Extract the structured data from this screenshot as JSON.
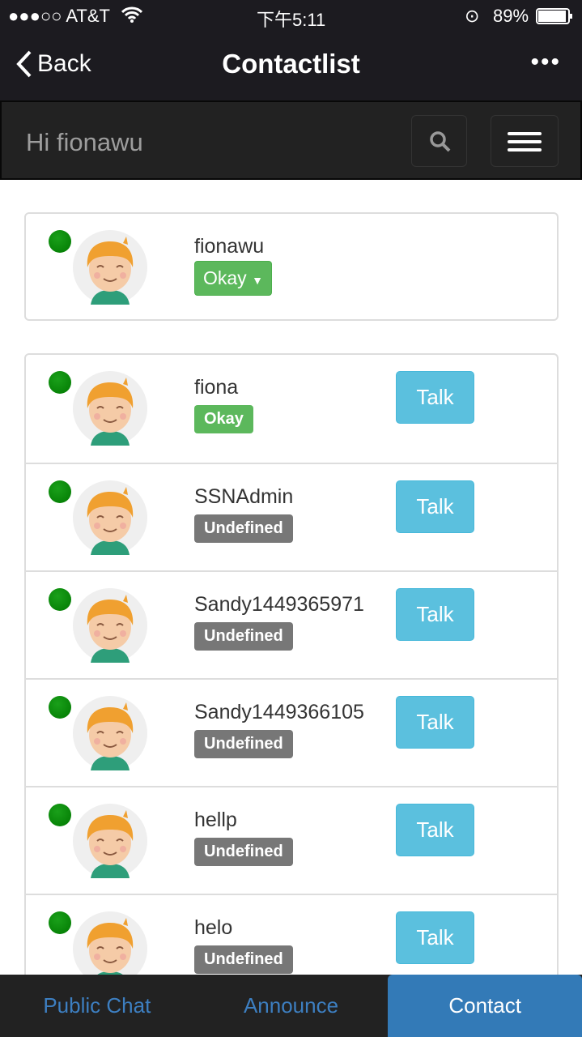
{
  "status": {
    "carrier": "●●●○○ AT&T",
    "time": "下午5:11",
    "battery": "89%"
  },
  "nav": {
    "back": "Back",
    "title": "Contactlist",
    "more": "•••"
  },
  "header": {
    "greeting": "Hi fionawu"
  },
  "me": {
    "name": "fionawu",
    "status": "Okay",
    "online": true
  },
  "contacts": [
    {
      "name": "fiona",
      "status": "Okay",
      "action": "Talk"
    },
    {
      "name": "SSNAdmin",
      "status": "Undefined",
      "action": "Talk"
    },
    {
      "name": "Sandy1449365971",
      "status": "Undefined",
      "action": "Talk"
    },
    {
      "name": "Sandy1449366105",
      "status": "Undefined",
      "action": "Talk"
    },
    {
      "name": "hellp",
      "status": "Undefined",
      "action": "Talk"
    },
    {
      "name": "helo",
      "status": "Undefined",
      "action": "Talk"
    }
  ],
  "tabs": [
    {
      "label": "Public Chat"
    },
    {
      "label": "Announce"
    },
    {
      "label": "Contact",
      "active": true
    }
  ],
  "colors": {
    "ok": "#5cb85c",
    "undefined": "#777777",
    "talk": "#5bc0de",
    "active_tab": "#337ab7",
    "online": "#008000"
  }
}
